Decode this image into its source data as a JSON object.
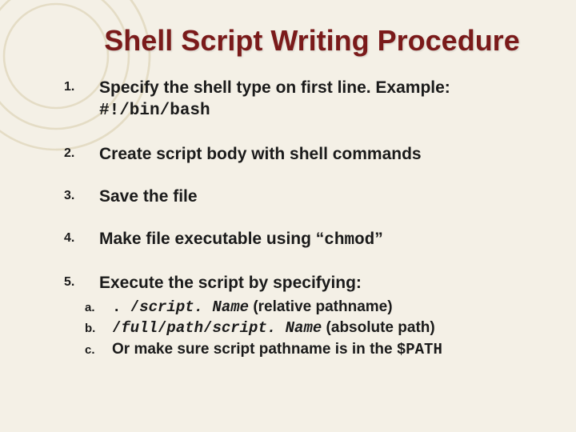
{
  "title": "Shell Script Writing Procedure",
  "items": {
    "i1": {
      "text": "Specify the shell type on first line.  Example:",
      "code": "#!/bin/bash"
    },
    "i2": {
      "text": "Create script body with shell commands"
    },
    "i3": {
      "text": "Save the file"
    },
    "i4": {
      "pre": "Make file executable using “",
      "code": "chmod",
      "post": "”"
    },
    "i5": {
      "text": "Execute the script by specifying:",
      "sub": {
        "a": {
          "prefix": ". /",
          "code": "script. Name",
          "suffix": "  (relative pathname)"
        },
        "b": {
          "prefix": "/",
          "code1": "full",
          "mid1": "/",
          "code2": "path",
          "mid2": "/",
          "code3": "script. Name",
          "suffix": "  (absolute path)"
        },
        "c": {
          "text": "Or make sure script pathname is in the ",
          "code": "$PATH"
        }
      }
    }
  }
}
